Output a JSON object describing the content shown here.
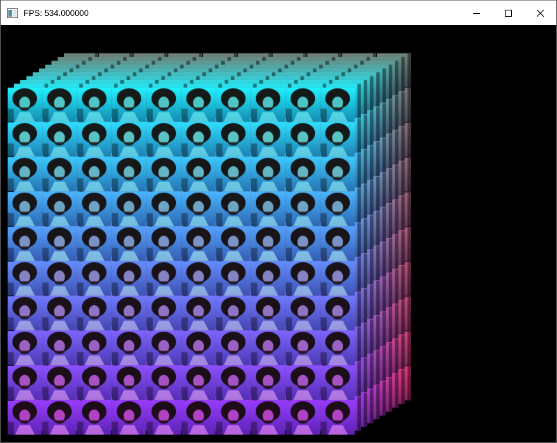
{
  "window": {
    "title": "FPS: 534.000000"
  },
  "titlebar": {
    "app_icon": "window-app-icon",
    "buttons": [
      {
        "name": "minimize",
        "icon": "minimize-icon"
      },
      {
        "name": "maximize",
        "icon": "maximize-icon"
      },
      {
        "name": "close",
        "icon": "close-icon"
      }
    ]
  },
  "scene": {
    "description_type": "3d-cube-of-textured-quads",
    "grid_columns": 10,
    "grid_rows": 10,
    "depth_layers": 10,
    "background_color": "#000000"
  }
}
